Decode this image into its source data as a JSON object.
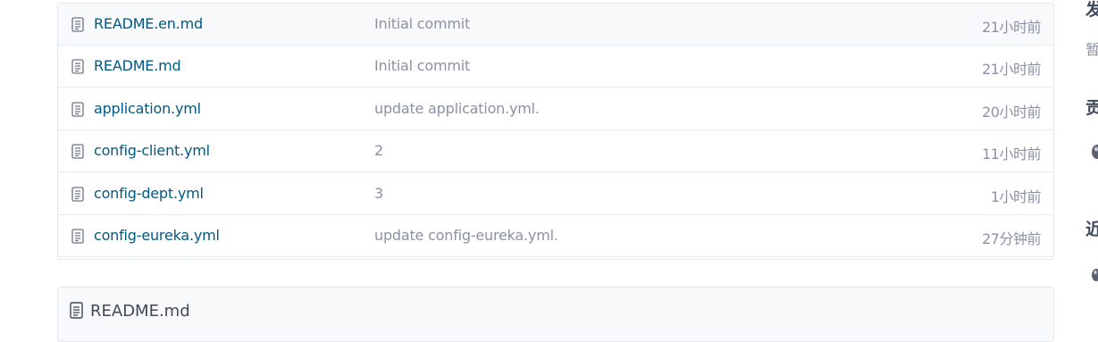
{
  "file_list": [
    {
      "name": "README.en.md",
      "message": "Initial commit",
      "time": "21小时前"
    },
    {
      "name": "README.md",
      "message": "Initial commit",
      "time": "21小时前"
    },
    {
      "name": "application.yml",
      "message": "update application.yml.",
      "time": "20小时前"
    },
    {
      "name": "config-client.yml",
      "message": "2",
      "time": "11小时前"
    },
    {
      "name": "config-dept.yml",
      "message": "3",
      "time": "1小时前"
    },
    {
      "name": "config-eureka.yml",
      "message": "update config-eureka.yml.",
      "time": "27分钟前"
    }
  ],
  "readme": {
    "title": "README.md"
  },
  "sidebar": {
    "release_heading": "发",
    "release_text": "暂",
    "contributors_heading": "贡",
    "recent_heading": "近"
  },
  "colors": {
    "link": "#005980",
    "muted": "#8c92a4",
    "border": "#e3e9ed"
  },
  "icons": {
    "file": "file-text-icon",
    "readme": "readme-file-icon",
    "avatar": "avatar"
  }
}
